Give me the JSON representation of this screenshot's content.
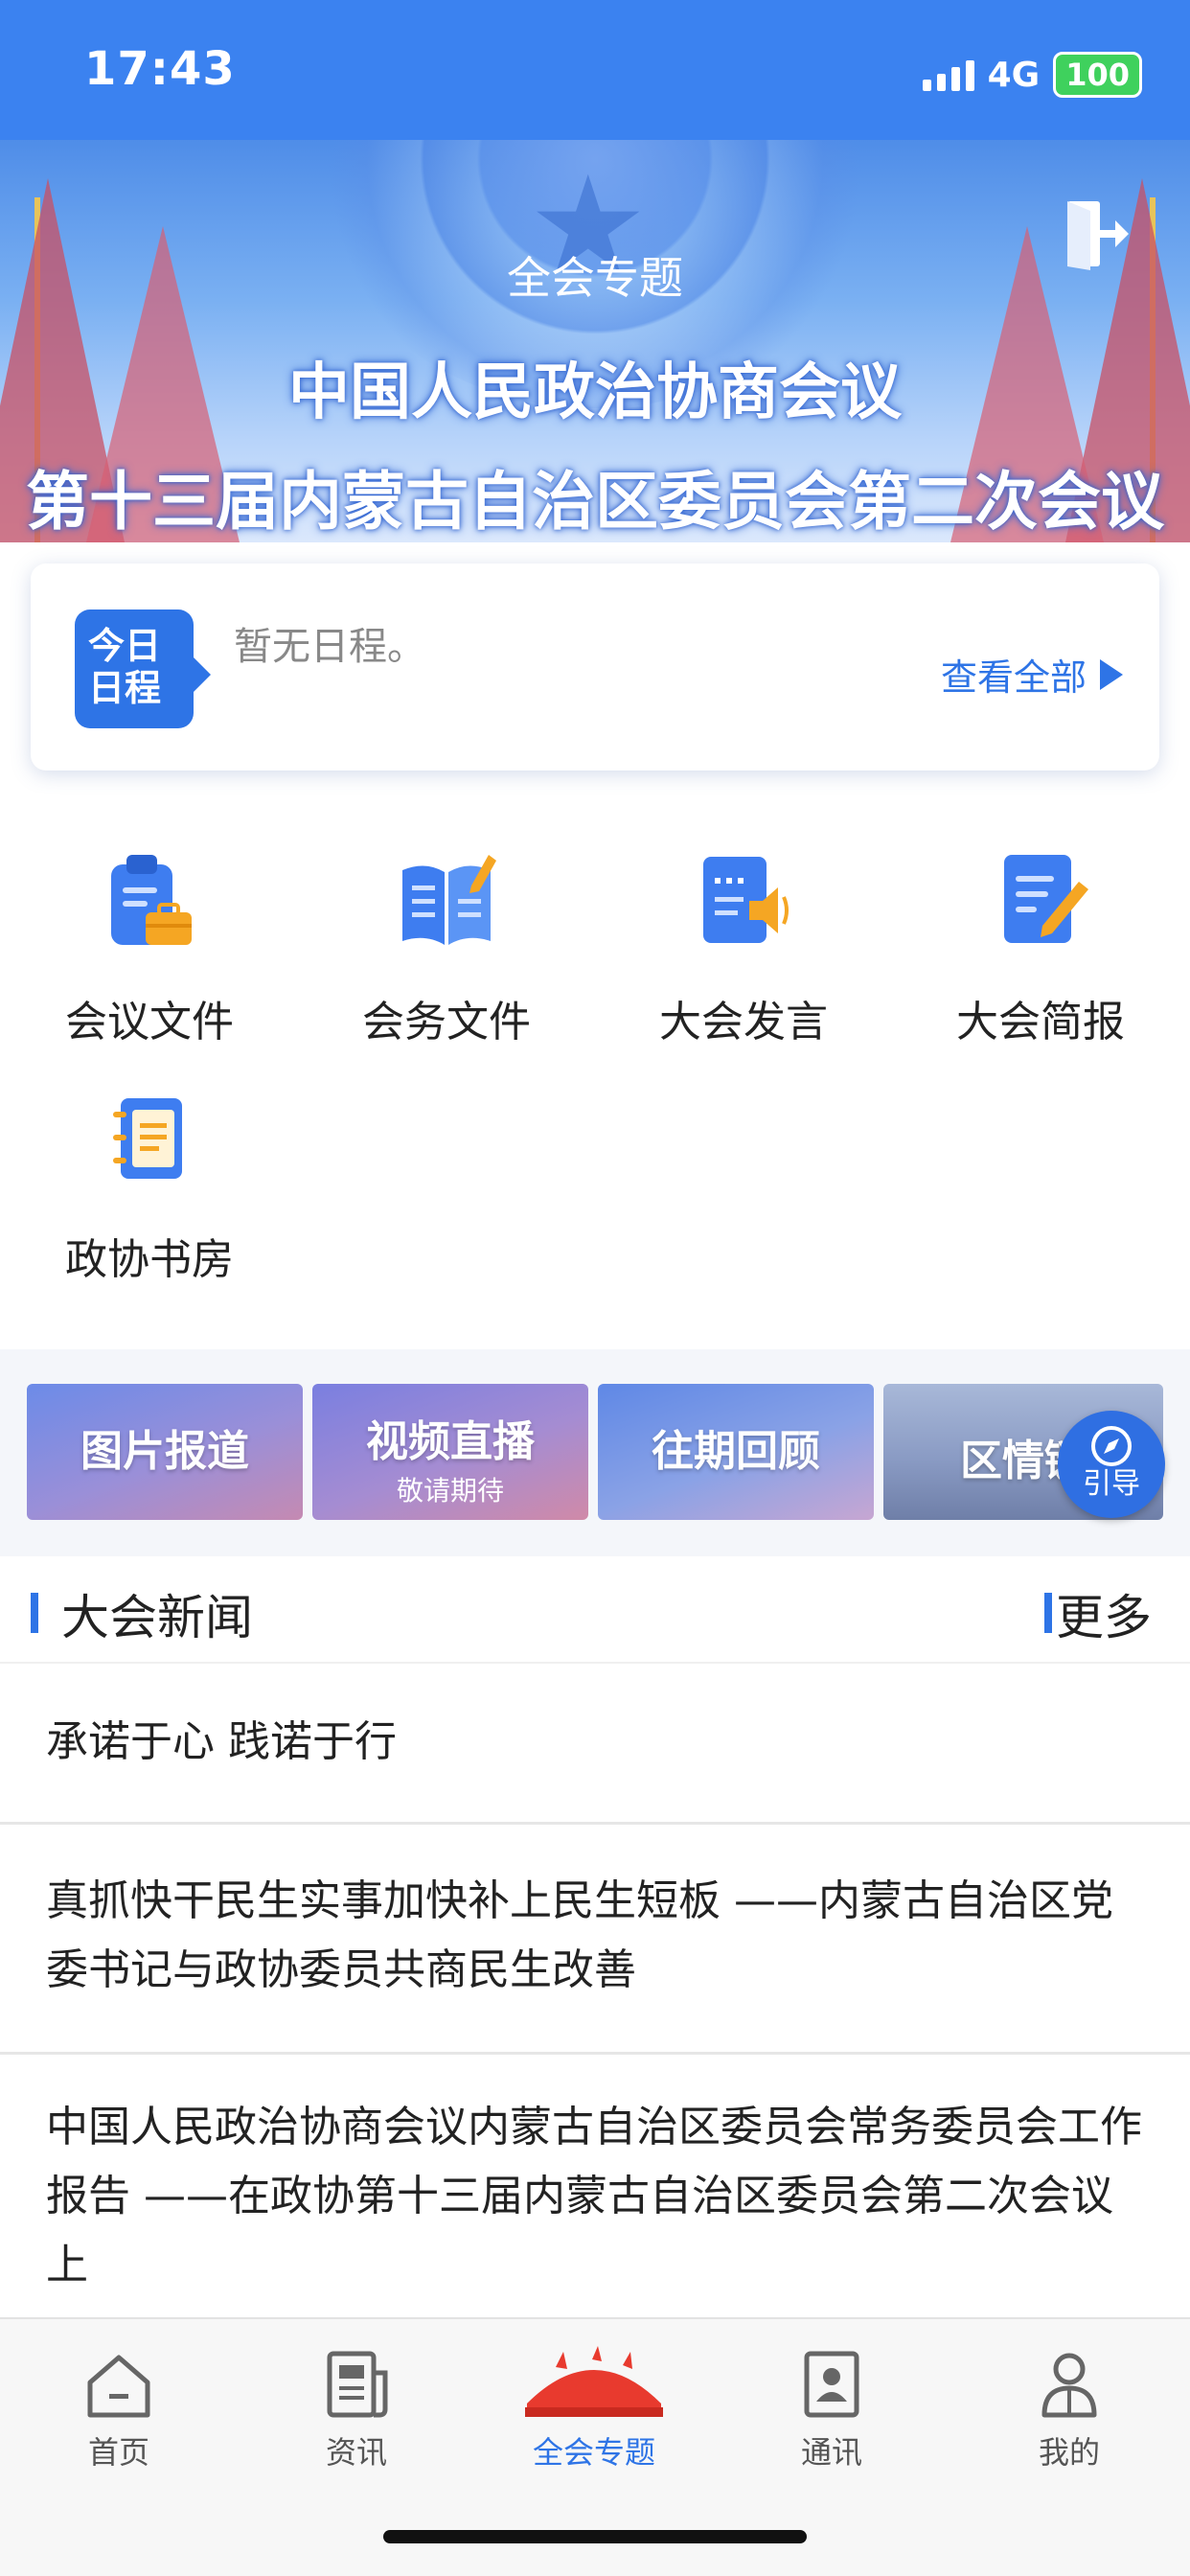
{
  "status_bar": {
    "time": "17:43",
    "network": "4G",
    "battery": "100"
  },
  "hero": {
    "subtitle": "全会专题",
    "title_line1": "中国人民政治协商会议",
    "title_line2": "第十三届内蒙古自治区委员会第二次会议"
  },
  "schedule": {
    "badge_line1": "今日",
    "badge_line2": "日程",
    "empty_text": "暂无日程。",
    "view_all": "查看全部"
  },
  "grid": {
    "items": [
      {
        "label": "会议文件",
        "icon": "clipboard-briefcase-icon"
      },
      {
        "label": "会务文件",
        "icon": "open-book-pen-icon"
      },
      {
        "label": "大会发言",
        "icon": "document-speaker-icon"
      },
      {
        "label": "大会简报",
        "icon": "document-pencil-icon"
      },
      {
        "label": "政协书房",
        "icon": "notebook-icon"
      }
    ]
  },
  "banners": [
    {
      "title": "图片报道",
      "subtitle": ""
    },
    {
      "title": "视频直播",
      "subtitle": "敬请期待"
    },
    {
      "title": "往期回顾",
      "subtitle": ""
    },
    {
      "title": "区情链",
      "subtitle": ""
    }
  ],
  "guide": {
    "label": "引导"
  },
  "news": {
    "section_title": "大会新闻",
    "more": "更多",
    "items": [
      {
        "title": "承诺于心 践诺于行"
      },
      {
        "title": "真抓快干民生实事加快补上民生短板 ——内蒙古自治区党委书记与政协委员共商民生改善"
      },
      {
        "title": "中国人民政治协商会议内蒙古自治区委员会常务委员会工作报告 ——在政协第十三届内蒙古自治区委员会第二次会议上"
      }
    ]
  },
  "tabs": [
    {
      "label": "首页",
      "icon": "home-icon"
    },
    {
      "label": "资讯",
      "icon": "newspaper-icon"
    },
    {
      "label": "全会专题",
      "icon": "great-hall-icon",
      "active": true
    },
    {
      "label": "通讯",
      "icon": "contacts-icon"
    },
    {
      "label": "我的",
      "icon": "user-icon"
    }
  ],
  "colors": {
    "primary": "#2e74e6",
    "status_bar": "#3b82f0",
    "battery": "#3fd15d",
    "active_tab_icon": "#e83a2e"
  }
}
